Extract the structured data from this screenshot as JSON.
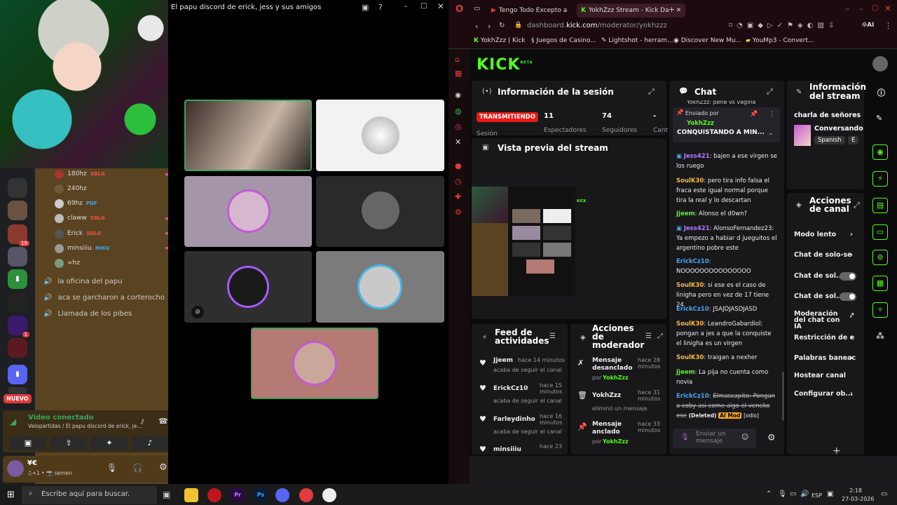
{
  "discord": {
    "call_title": "El papu discord de erick, jess y sus amigos",
    "voice_users": [
      {
        "name": "180hz",
        "tag": "SDLG",
        "badge_color": "#e8594a"
      },
      {
        "name": "240hz",
        "tag": "",
        "badge_color": ""
      },
      {
        "name": "69hz",
        "tag": "PDF",
        "badge_color": "#4aa3e8"
      },
      {
        "name": "claww",
        "tag": "SDLG",
        "badge_color": "#e8594a"
      },
      {
        "name": "Erick",
        "tag": "SDLG",
        "badge_color": "#e8594a"
      },
      {
        "name": "minsiiiu",
        "tag": "MIKU",
        "badge_color": "#4aa3e8"
      },
      {
        "name": "∞hz",
        "tag": "",
        "badge_color": ""
      }
    ],
    "channels": [
      "la oficina del papu",
      "aca se garcharon a corterocho",
      "Llamada de los pibes"
    ],
    "server_badges": [
      "19",
      "1"
    ],
    "new_label": "NUEVO",
    "voice_status": "Video conectado",
    "voice_channel": "Valopartidas / El papu discord de erick, je...",
    "user_name": "¥€",
    "user_status": "♫+1 • 📸 semen"
  },
  "browser": {
    "tabs": [
      {
        "label": "Tengo Todo Excepto a"
      },
      {
        "label": "YokhZzz Stream - Kick Da"
      }
    ],
    "url_domain": "dashboard.",
    "url_host": "kick.com",
    "url_path": "/moderator/yokhzzz",
    "bookmarks": [
      "YokhZzz | Kick",
      "Juegos de Casino...",
      "Lightshot - herram...",
      "Discover New Mu...",
      "YouMp3 - Convert..."
    ]
  },
  "kick": {
    "logo": "KICK",
    "logo_sup": "BETA",
    "session": {
      "title": "Información de la sesión",
      "live_badge": "TRANSMITIENDO",
      "live_sub": "Sesión",
      "stats": [
        {
          "value": "11",
          "label": "Espectadores"
        },
        {
          "value": "74",
          "label": "Seguidores"
        },
        {
          "value": "-",
          "label": "Cant"
        }
      ]
    },
    "preview_title": "Vista previa del stream",
    "feed": {
      "title": "Feed de actividades",
      "items": [
        {
          "user": "Jjeem",
          "time": "hace 14 minutos",
          "action": "acaba de seguir el canal"
        },
        {
          "user": "ErickCz10",
          "time": "hace 15 minutos",
          "action": "acaba de seguir el canal"
        },
        {
          "user": "Farleydinho",
          "time": "hace 16 minutos",
          "action": "acaba de seguir el canal"
        },
        {
          "user": "minsiiiu",
          "time": "hace 23",
          "action": ""
        }
      ]
    },
    "mod_actions": {
      "title": "Acciones de moderador",
      "items": [
        {
          "label": "Mensaje desanclado",
          "by": "por",
          "user": "YokhZzz",
          "time": "hace 28 minutos"
        },
        {
          "label": "YokhZzz",
          "by": "eliminó un mensaje",
          "user": "",
          "time": "hace 31 minutos"
        },
        {
          "label": "Mensaje anclado",
          "by": "por",
          "user": "YokhZzz",
          "time": "hace 33 minutos"
        }
      ]
    },
    "chat": {
      "title": "Chat",
      "pinned_top": "YokhZzz: pene vs vagina",
      "pinned_by": "Enviado por",
      "pinned_user": "YokhZzz",
      "pinned_msg": "CONQUISTANDO A MIN...",
      "messages": [
        {
          "user": "Jess421",
          "color": "#b57bff",
          "text": "bajen a ese virgen se los ruego"
        },
        {
          "user": "SoulK30",
          "color": "#f5b83d",
          "text": "pero tira info falsa el fraca este igual normal porque tira la real y lo descartan"
        },
        {
          "user": "Jjeem",
          "color": "#53fc18",
          "text": "Alonso el d0wn?"
        },
        {
          "user": "Jess421",
          "color": "#b57bff",
          "text": "AlonsoFernandez23: Ya empezo a habiar d jueguitos el argentino pobre este"
        },
        {
          "user": "ErickCz10",
          "color": "#4aa3e8",
          "text": "NOOOOOOOOOOOOOOO"
        },
        {
          "user": "SoulK30",
          "color": "#f5b83d",
          "text": "si ese es el caso de linigha pero en vez de 17 tiene 24"
        },
        {
          "user": "ErickCz10",
          "color": "#4aa3e8",
          "text": "JSAJDJASDJASD"
        },
        {
          "user": "SoulK30",
          "color": "#f5b83d",
          "text": "LeandroGabardiol: pongan a jes a que la conquiste el linigha es un virgen"
        },
        {
          "user": "SoulK30",
          "color": "#f5b83d",
          "text": "traigan a nexher"
        },
        {
          "user": "Jjeem",
          "color": "#53fc18",
          "text": "La pija no cuenta como novia"
        },
        {
          "user": "ErickCz10",
          "color": "#4aa3e8",
          "text": "Elmascapito: Pongan a coby asi come algo el veneko ese"
        }
      ],
      "deleted_label": "(Deleted)",
      "ai_mod_label": "AI Mod",
      "odio_label": "[odio]",
      "input_placeholder": "Enviar un mensaje"
    },
    "stream_info": {
      "title": "Información del stream",
      "stream_title": "charla de señores",
      "category": "Conversando",
      "language": "Spanish",
      "extra_tag": "E"
    },
    "channel_actions": {
      "title": "Acciones de canal",
      "items": [
        "Modo lento",
        "Chat de solo-se",
        "Chat de sol...",
        "Chat de sol...",
        "Moderación del chat con IA",
        "Restricción de e",
        "Palabras baneac",
        "Hostear canal",
        "Configurar ob..."
      ]
    }
  },
  "taskbar": {
    "search_placeholder": "Escribe aquí para buscar.",
    "lang": "ESP",
    "time": "2:18",
    "date": "27-03-2026"
  }
}
